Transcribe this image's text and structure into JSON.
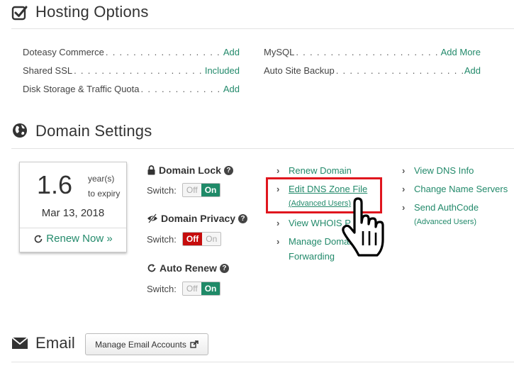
{
  "hosting": {
    "title": "Hosting Options",
    "left": [
      {
        "label": "Doteasy Commerce",
        "value": "Add"
      },
      {
        "label": "Shared SSL",
        "value": "Included"
      },
      {
        "label": "Disk Storage & Traffic Quota",
        "value": "Add"
      }
    ],
    "right": [
      {
        "label": "MySQL",
        "value": "Add More"
      },
      {
        "label": "Auto Site Backup",
        "value": "Add"
      }
    ]
  },
  "domain": {
    "title": "Domain Settings",
    "years_value": "1.6",
    "years_unit": "year(s)",
    "years_sub": "to expiry",
    "expiry_date": "Mar 13, 2018",
    "renew_label": "Renew Now »",
    "lock": {
      "title": "Domain Lock",
      "switch_label": "Switch:",
      "off": "Off",
      "on": "On"
    },
    "privacy": {
      "title": "Domain Privacy",
      "switch_label": "Switch:",
      "off": "Off",
      "on": "On"
    },
    "autorenew": {
      "title": "Auto Renew",
      "switch_label": "Switch:",
      "off": "Off",
      "on": "On"
    },
    "links_col1": {
      "renew_domain": "Renew Domain",
      "edit_dns": "Edit DNS Zone File",
      "edit_dns_note": "(Advanced Users)",
      "view_whois": "View WHOIS P",
      "manage_forwarding_1": "Manage Domain",
      "manage_forwarding_2": "Forwarding"
    },
    "links_col2": {
      "view_dns": "View DNS Info",
      "change_ns": "Change Name Servers",
      "send_auth": "Send AuthCode",
      "send_auth_note": "(Advanced Users)"
    },
    "highlight_color": "#e0161e"
  },
  "email": {
    "title": "Email",
    "manage_button": "Manage Email Accounts"
  },
  "colors": {
    "link": "#238a6b",
    "toggle_on": "#1f8a68",
    "toggle_privacy_off": "#c60c0c"
  },
  "dots": ". . . . . . . . . . . . . . . . . . . . . . . . . . . . . . . . . . . . . . . . . . . . . . . . . . . ."
}
